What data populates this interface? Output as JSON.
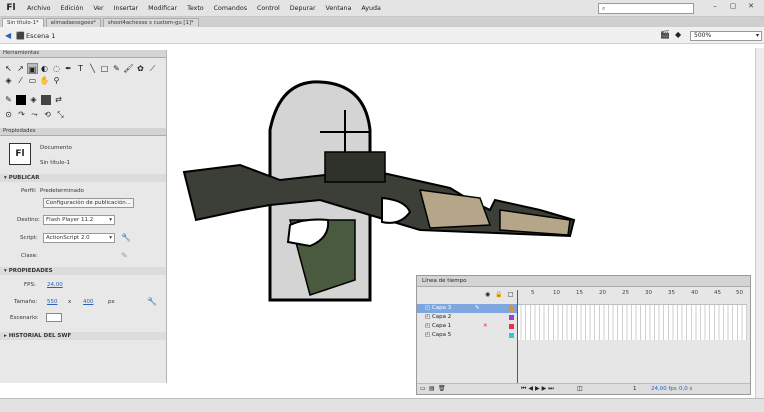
{
  "app": {
    "logo": "Fl"
  },
  "menu": [
    "Archivo",
    "Edición",
    "Ver",
    "Insertar",
    "Modificar",
    "Texto",
    "Comandos",
    "Control",
    "Depurar",
    "Ventana",
    "Ayuda"
  ],
  "window": {
    "minimize": "–",
    "maximize": "▢",
    "close": "✕"
  },
  "tabs": [
    "Sin título-1*",
    "alimadaessgoes*",
    "shoot4achesse s custom-gu [1]*"
  ],
  "scene": {
    "label": "Escena 1",
    "zoom": "500%"
  },
  "tools_panel": {
    "title": "Herramientas"
  },
  "properties": {
    "title": "Propiedades",
    "doc_type": "Documento",
    "doc_name": "Sin título-1",
    "section_publish": "PUBLICAR",
    "profile_label": "Perfil:",
    "profile_value": "Predeterminado",
    "publish_settings_button": "Configuración de publicación...",
    "target_label": "Destino:",
    "target_value": "Flash Player 11.2",
    "script_label": "Script:",
    "script_value": "ActionScript 2.0",
    "class_label": "Clase:",
    "section_properties": "PROPIEDADES",
    "fps_label": "FPS:",
    "fps_value": "24,00",
    "size_label": "Tamaño:",
    "width": "550",
    "x": "x",
    "height": "400",
    "unit": "px",
    "stage_label": "Escenario:",
    "stage_color": "#ffffff",
    "section_history": "HISTORIAL DEL SWF"
  },
  "timeline": {
    "title": "Línea de tiempo",
    "frame_ticks": [
      "5",
      "10",
      "15",
      "20",
      "25",
      "30",
      "35",
      "40",
      "45",
      "50"
    ],
    "layers": [
      {
        "name": "Capa 3",
        "color": "#e0922a",
        "selected": true
      },
      {
        "name": "Capa 2",
        "color": "#9b3fcf",
        "selected": false
      },
      {
        "name": "Capa 1",
        "color": "#e0364a",
        "selected": false
      },
      {
        "name": "Capa 5",
        "color": "#35c6d6",
        "selected": false
      }
    ],
    "status_frame": "1",
    "status_fps": "24,00 fps",
    "status_time": "0,0 s"
  },
  "colors": {
    "accent": "#7ea6df",
    "playhead": "#e02020"
  }
}
